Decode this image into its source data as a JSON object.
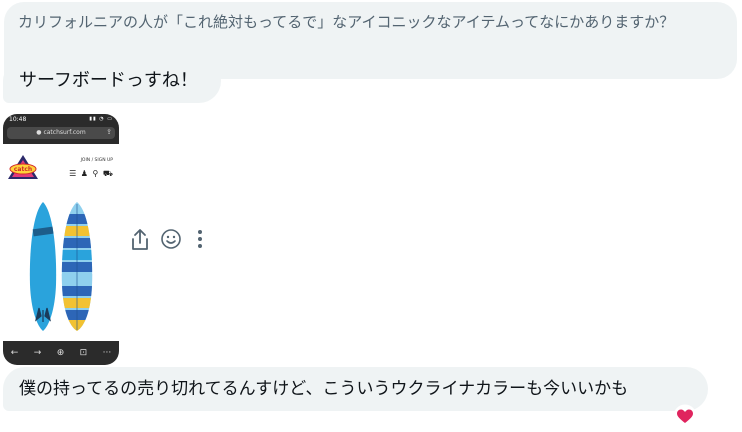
{
  "messages": {
    "question": "カリフォルニアの人が「これ絶対もってるで」なアイコニックなアイテムってなにかありますか？",
    "answer": "サーフボードっすね！",
    "comment": "僕の持ってるの売り切れてるんすけど、こういうウクライナカラーも今いいかも"
  },
  "shared_image": {
    "status_time": "10:48",
    "url": "catchsurf.com",
    "join_label": "JOIN / SIGN UP"
  },
  "actions": {
    "share_icon": "share-icon",
    "react_icon": "emoji-react-icon",
    "more_icon": "more-vertical-icon",
    "reaction": "heart"
  },
  "colors": {
    "bubble": "#eff3f4",
    "question_text": "#536471",
    "board_blue": "#2aa3dc",
    "stripe_yellow": "#f2c232",
    "stripe_blue": "#2d66b7",
    "heart_red": "#e0245e"
  }
}
